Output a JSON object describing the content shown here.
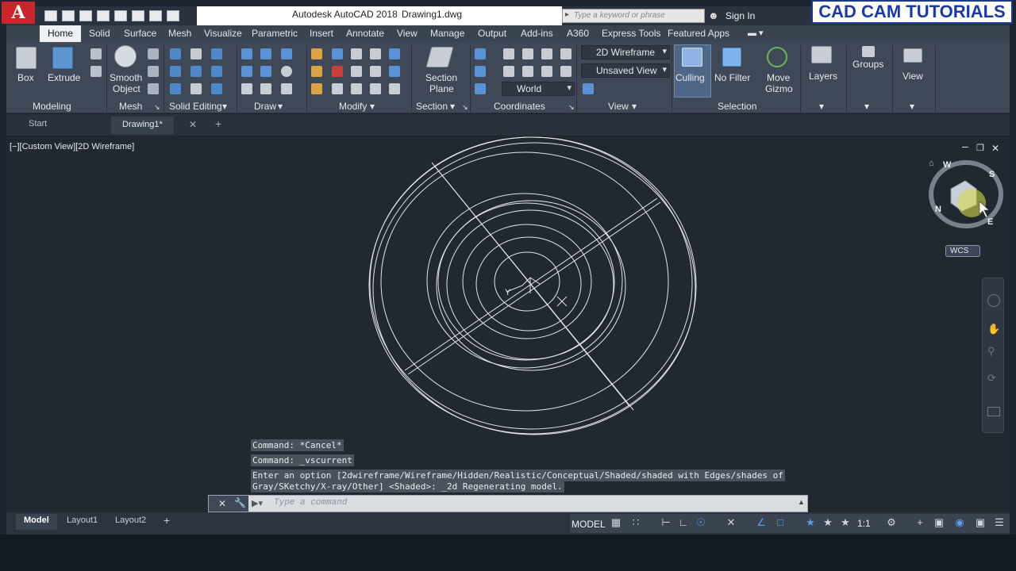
{
  "titlebar": {
    "app_title": "Autodesk AutoCAD 2018",
    "file_name": "Drawing1.dwg",
    "search_placeholder": "Type a keyword or phrase",
    "sign_in": "Sign In",
    "watermark": "CAD CAM TUTORIALS",
    "logo_letter": "A"
  },
  "ribbon_tabs": [
    "Home",
    "Solid",
    "Surface",
    "Mesh",
    "Visualize",
    "Parametric",
    "Insert",
    "Annotate",
    "View",
    "Manage",
    "Output",
    "Add-ins",
    "A360",
    "Express Tools",
    "Featured Apps"
  ],
  "ribbon": {
    "modeling": {
      "title": "Modeling",
      "box": "Box",
      "extrude": "Extrude"
    },
    "mesh": {
      "title": "Mesh",
      "smooth_object_1": "Smooth",
      "smooth_object_2": "Object"
    },
    "solid_editing": {
      "title": "Solid Editing"
    },
    "draw": {
      "title": "Draw"
    },
    "modify": {
      "title": "Modify"
    },
    "section": {
      "title": "Section",
      "section_plane_1": "Section",
      "section_plane_2": "Plane"
    },
    "coordinates": {
      "title": "Coordinates",
      "ucs_value": "World"
    },
    "view": {
      "title": "View",
      "visual_style": "2D Wireframe",
      "named_view": "Unsaved View"
    },
    "selection": {
      "title": "Selection",
      "culling": "Culling",
      "no_filter": "No Filter",
      "move_gizmo_1": "Move",
      "move_gizmo_2": "Gizmo"
    },
    "layers": {
      "label": "Layers"
    },
    "groups": {
      "label": "Groups"
    },
    "view_panel": {
      "label": "View"
    }
  },
  "file_tabs": {
    "start": "Start",
    "drawing": "Drawing1*"
  },
  "viewport": {
    "label": "[−][Custom View][2D Wireframe]",
    "wcs": "WCS",
    "compass": {
      "w": "W",
      "s": "S",
      "n": "N",
      "e": "E"
    }
  },
  "command": {
    "history": [
      "Command: *Cancel*",
      "Command: _vscurrent",
      "Enter an option [2dwireframe/Wireframe/Hidden/Realistic/Conceptual/Shaded/shaded with Edges/shades of",
      "Gray/SKetchy/X-ray/Other] <Shaded>: _2d Regenerating model."
    ],
    "placeholder": "Type a command"
  },
  "status": {
    "layout_tabs": [
      "Model",
      "Layout1",
      "Layout2"
    ],
    "model": "MODEL",
    "scale": "1:1"
  }
}
